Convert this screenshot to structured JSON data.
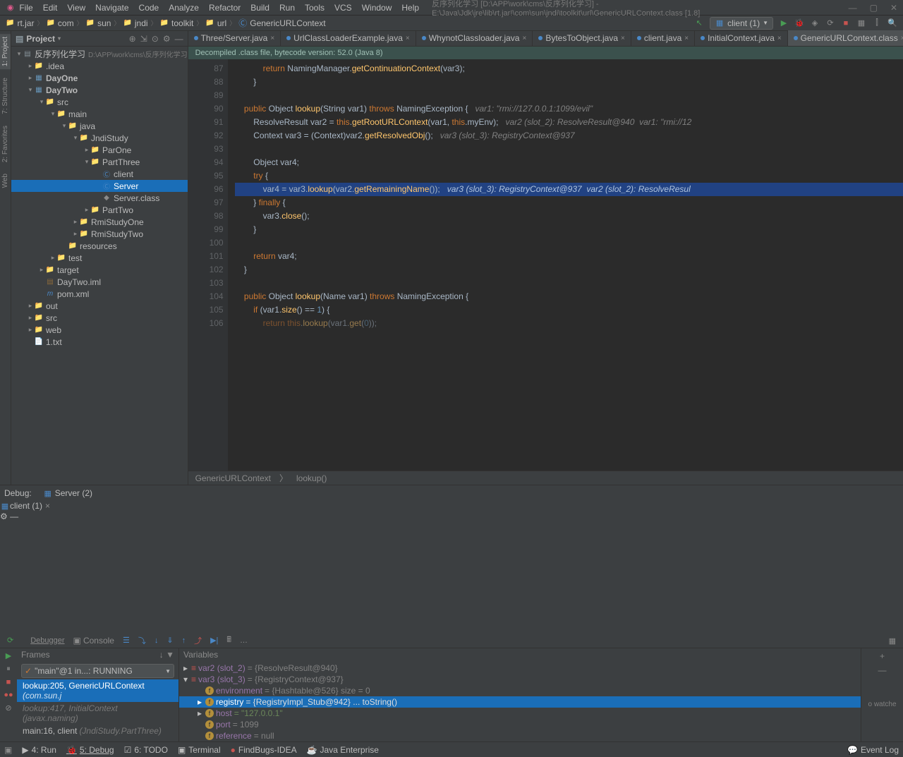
{
  "menu": [
    "File",
    "Edit",
    "View",
    "Navigate",
    "Code",
    "Analyze",
    "Refactor",
    "Build",
    "Run",
    "Tools",
    "VCS",
    "Window",
    "Help"
  ],
  "window_title": "反序列化学习 [D:\\APP\\work\\cms\\反序列化学习] - E:\\Java\\Jdk\\jre\\lib\\rt.jar!\\com\\sun\\jndi\\toolkit\\url\\GenericURLContext.class [1.8]",
  "breadcrumb": [
    "rt.jar",
    "com",
    "sun",
    "jndi",
    "toolkit",
    "url",
    "GenericURLContext"
  ],
  "run_config": "client (1)",
  "project_title": "Project",
  "tree": {
    "root": {
      "label": "反序列化学习",
      "hint": "D:\\APP\\work\\cms\\反序列化学习"
    },
    "idea": ".idea",
    "dayone": "DayOne",
    "daytwo": "DayTwo",
    "src": "src",
    "main": "main",
    "java": "java",
    "jndistudy": "JndiStudy",
    "parone": "ParOne",
    "parthree": "PartThree",
    "client": "client",
    "server": "Server",
    "serverclass": "Server.class",
    "parttwo": "PartTwo",
    "rmistudyone": "RmiStudyOne",
    "rmistudytwo": "RmiStudyTwo",
    "resources": "resources",
    "test": "test",
    "target": "target",
    "daytwoiml": "DayTwo.iml",
    "pomxml": "pom.xml",
    "out": "out",
    "src2": "src",
    "web": "web",
    "txt": "1.txt"
  },
  "tabs": [
    {
      "name": "Three/Server.java",
      "active": false
    },
    {
      "name": "UrlClassLoaderExample.java",
      "active": false
    },
    {
      "name": "WhynotClassloader.java",
      "active": false
    },
    {
      "name": "BytesToObject.java",
      "active": false
    },
    {
      "name": "client.java",
      "active": false
    },
    {
      "name": "InitialContext.java",
      "active": false
    },
    {
      "name": "GenericURLContext.class",
      "active": true
    }
  ],
  "banner": "Decompiled .class file, bytecode version: 52.0 (Java 8)",
  "gutter": [
    "87",
    "88",
    "89",
    "90",
    "91",
    "92",
    "93",
    "94",
    "95",
    "96",
    "97",
    "98",
    "99",
    "100",
    "101",
    "102",
    "103",
    "104",
    "105",
    "106"
  ],
  "code": {
    "l87": "                return NamingManager.getContinuationContext(var3);",
    "l88": "            }",
    "l90": "        public Object lookup(String var1) throws NamingException {   var1: \"rmi://127.0.0.1:1099/evil\"",
    "l91": "            ResolveResult var2 = this.getRootURLContext(var1, this.myEnv);   var2 (slot_2): ResolveResult@940  var1: \"rmi://12",
    "l92": "            Context var3 = (Context)var2.getResolvedObj();   var3 (slot_3): RegistryContext@937",
    "l94": "            Object var4;",
    "l95": "            try {",
    "l96": "                var4 = var3.lookup(var2.getRemainingName());   var3 (slot_3): RegistryContext@937  var2 (slot_2): ResolveResul",
    "l97": "            } finally {",
    "l98": "                var3.close();",
    "l99": "            }",
    "l101": "            return var4;",
    "l102": "        }",
    "l104": "        public Object lookup(Name var1) throws NamingException {",
    "l105": "            if (var1.size() == 1) {",
    "l106": "                return this.lookup(var1.get(0));"
  },
  "editor_breadcrumb": [
    "GenericURLContext",
    "lookup()"
  ],
  "debug": {
    "label": "Debug:",
    "tabs": [
      {
        "name": "Server (2)",
        "active": false
      },
      {
        "name": "client (1)",
        "active": true
      }
    ],
    "subTabs": [
      "Debugger",
      "Console"
    ],
    "frames_title": "Frames",
    "vars_title": "Variables",
    "thread": "\"main\"@1 in...: RUNNING",
    "frames": [
      {
        "text": "lookup:205, GenericURLContext",
        "hint": "(com.sun.j",
        "sel": true
      },
      {
        "text": "lookup:417, InitialContext",
        "hint": "(javax.naming)",
        "dim": true
      },
      {
        "text": "main:16, client",
        "hint": "(JndiStudy.PartThree)"
      }
    ],
    "vars": [
      {
        "tri": "▸",
        "name": "var2 (slot_2)",
        "val": "= {ResolveResult@940}",
        "typ": "obj"
      },
      {
        "tri": "▾",
        "name": "var3 (slot_3)",
        "val": "= {RegistryContext@937}",
        "typ": "obj"
      },
      {
        "tri": "",
        "indent": 1,
        "name": "environment",
        "val": "= {Hashtable@526}  size = 0",
        "typ": "field"
      },
      {
        "tri": "▸",
        "indent": 1,
        "name": "registry",
        "val": "= {RegistryImpl_Stub@942}  ... toString()",
        "typ": "field",
        "sel": true
      },
      {
        "tri": "▸",
        "indent": 1,
        "name": "host",
        "val": "= \"127.0.0.1\"",
        "typ": "field",
        "green": true
      },
      {
        "tri": "",
        "indent": 1,
        "name": "port",
        "val": "= 1099",
        "typ": "field"
      },
      {
        "tri": "",
        "indent": 1,
        "name": "reference",
        "val": "= null",
        "typ": "field"
      }
    ],
    "watch_hint": "o watche"
  },
  "statusbar": {
    "items": [
      {
        "icon": "▶",
        "text": "4: Run"
      },
      {
        "icon": "🐞",
        "text": "5: Debug",
        "active": true
      },
      {
        "icon": "☑",
        "text": "6: TODO"
      },
      {
        "icon": "▣",
        "text": "Terminal"
      },
      {
        "icon": "●",
        "text": "FindBugs-IDEA"
      },
      {
        "icon": "☕",
        "text": "Java Enterprise"
      }
    ],
    "right": "Event Log"
  }
}
